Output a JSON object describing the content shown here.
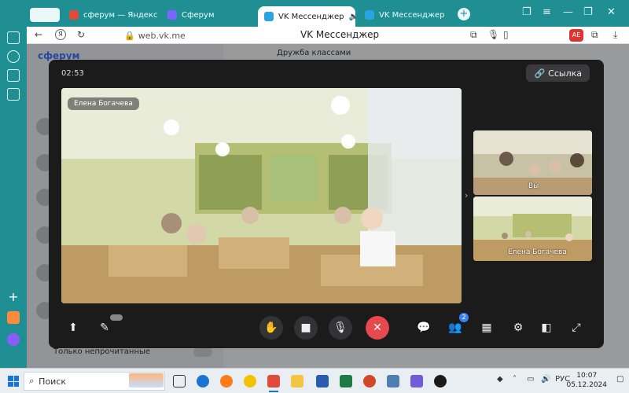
{
  "browser": {
    "tabs": [
      {
        "label": "сферум — Яндекс: нашло",
        "color": "#e14b3c"
      },
      {
        "label": "Сферум",
        "color": "#7a66ff"
      },
      {
        "label": "VK Мессенджер",
        "color": "#2aa4e0"
      },
      {
        "label": "VK Мессенджер",
        "color": "#2aa4e0"
      }
    ],
    "url": "web.vk.me",
    "page_title": "VK Мессенджер",
    "profile_badge": "АЕ"
  },
  "vk": {
    "logo": "сферум",
    "chat_title": "Дружба классами",
    "unread_toggle_label": "Только непрочитанные"
  },
  "call": {
    "timer": "02:53",
    "link_button": "Ссылка",
    "main_participant": "Елена Богачева",
    "side_tiles": [
      {
        "label": "Вы"
      },
      {
        "label": "Елена Богачева"
      }
    ],
    "participants_count": "2"
  },
  "taskbar": {
    "search_placeholder": "Поиск",
    "language": "РУС",
    "time": "10:07",
    "date": "05.12.2024"
  },
  "colors": {
    "end_call": "#e5484d",
    "call_bg": "#1b1b1c",
    "accent": "#3b82f6"
  }
}
